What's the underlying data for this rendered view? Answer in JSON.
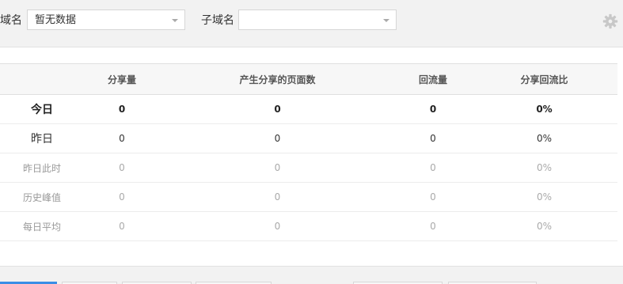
{
  "filters": {
    "domain_label": "域名",
    "domain_value": "暂无数据",
    "subdomain_label": "子域名",
    "subdomain_value": ""
  },
  "table": {
    "headers": [
      "",
      "分享量",
      "产生分享的页面数",
      "回流量",
      "分享回流比"
    ],
    "rows": [
      {
        "label": "今日",
        "values": [
          "0",
          "0",
          "0",
          "0%"
        ]
      },
      {
        "label": "昨日",
        "values": [
          "0",
          "0",
          "0",
          "0%"
        ]
      },
      {
        "label": "昨日此时",
        "values": [
          "0",
          "0",
          "0",
          "0%"
        ]
      },
      {
        "label": "历史峰值",
        "values": [
          "0",
          "0",
          "0",
          "0%"
        ]
      },
      {
        "label": "每日平均",
        "values": [
          "0",
          "0",
          "0",
          "0%"
        ]
      }
    ]
  },
  "icons": {
    "settings": "gear-icon",
    "dropdown": "chevron-down-icon"
  },
  "colors": {
    "accent": "#3a8ee6",
    "header_bg": "#f7f7f7",
    "page_bg": "#f2f2f2"
  }
}
